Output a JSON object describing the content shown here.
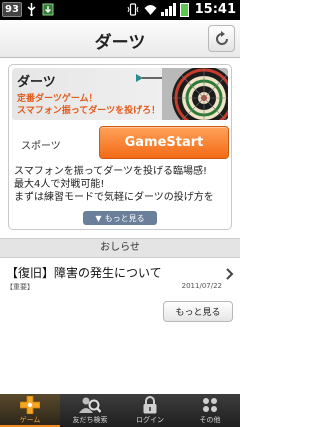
{
  "status_bar": {
    "badge": "93",
    "time": "15:41"
  },
  "header": {
    "title": "ダーツ"
  },
  "game": {
    "banner_title": "ダーツ",
    "banner_line1": "定番ダーツゲーム！",
    "banner_line2": "スマフォン振ってダーツを投げろ！",
    "category": "スポーツ",
    "start_label": "GameStart",
    "description": [
      "スマフォンを振ってダーツを投げる臨場感!",
      "最大4人で対戦可能!",
      "まずは練習モードで気軽にダーツの投げ方を"
    ],
    "more_label": "もっと見る"
  },
  "notices": {
    "header": "おしらせ",
    "items": [
      {
        "title": "【復旧】障害の発生について",
        "tag": "【重要】",
        "date": "2011/07/22"
      }
    ],
    "more_button": "もっと見る"
  },
  "bottom_nav": {
    "items": [
      {
        "label": "ゲーム",
        "icon": "game-icon",
        "active": true
      },
      {
        "label": "友だち検索",
        "icon": "friend-search-icon",
        "active": false
      },
      {
        "label": "ログイン",
        "icon": "lock-icon",
        "active": false
      },
      {
        "label": "その他",
        "icon": "other-icon",
        "active": false
      }
    ]
  },
  "colors": {
    "accent_orange": "#f26b16",
    "banner_orange_text": "#e05a1a",
    "nav_background": "#2b2b2b",
    "more_tab": "#6a7f99"
  }
}
